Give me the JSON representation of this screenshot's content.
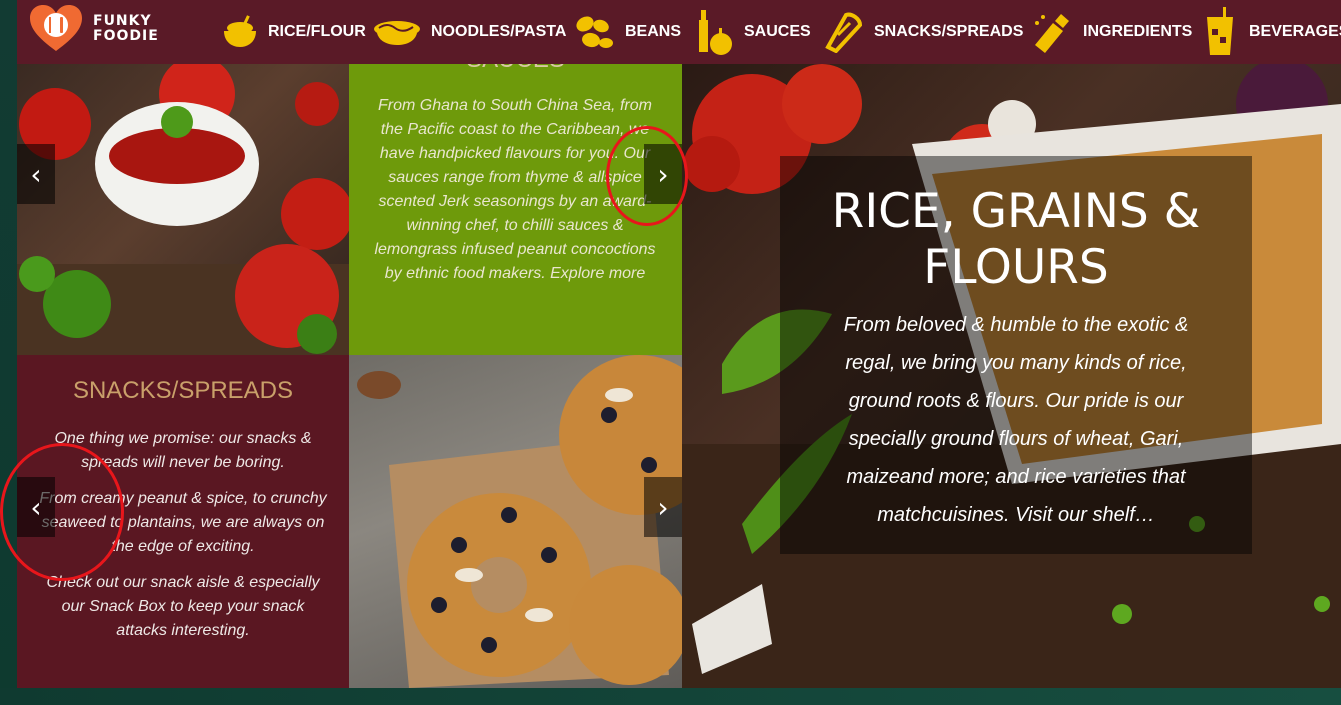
{
  "brand": {
    "line1": "FUNKY",
    "line2": "FOODIE"
  },
  "nav": [
    {
      "label": "RICE/FLOUR",
      "icon": "rice-bowl-icon"
    },
    {
      "label": "NOODLES/PASTA",
      "icon": "noodle-bowl-icon"
    },
    {
      "label": "BEANS",
      "icon": "beans-icon"
    },
    {
      "label": "SAUCES",
      "icon": "sauce-bottle-icon"
    },
    {
      "label": "SNACKS/SPREADS",
      "icon": "snack-icon"
    },
    {
      "label": "INGREDIENTS",
      "icon": "shaker-icon"
    },
    {
      "label": "BEVERAGES",
      "icon": "drink-icon"
    }
  ],
  "sauces": {
    "title": "SAUCES",
    "text": "From Ghana to South China Sea, from the Pacific coast to the Caribbean, we have handpicked flavours for you. Our sauces range from thyme & allspice scented Jerk seasonings by an award-winning chef, to chilli sauces & lemongrass infused peanut concoctions by ethnic food makers. Explore more"
  },
  "snacks": {
    "title": "SNACKS/SPREADS",
    "p1": "One thing we promise: our snacks & spreads will never be boring.",
    "p2": "From creamy peanut & spice, to crunchy seaweed to plantains, we are always on the edge of exciting.",
    "p3": "Check out our snack aisle & especially our Snack Box to keep your snack attacks interesting."
  },
  "hero": {
    "title": "RICE, GRAINS & FLOURS",
    "text": "From beloved & humble to the exotic & regal, we bring you many kinds of rice, ground roots & flours. Our pride is our specially ground flours of wheat, Gari, maizeand more; and rice varieties that matchcuisines. Visit our shelf…"
  },
  "arrows": {
    "prev": "‹",
    "next": "›"
  },
  "colors": {
    "nav_bg": "#5a1a27",
    "icon_yellow": "#f2c100",
    "sauces_bg": "#6e9a0b",
    "snacks_bg": "#5a1722",
    "snacks_title": "#c9a06a",
    "annotation": "#e8161b"
  }
}
